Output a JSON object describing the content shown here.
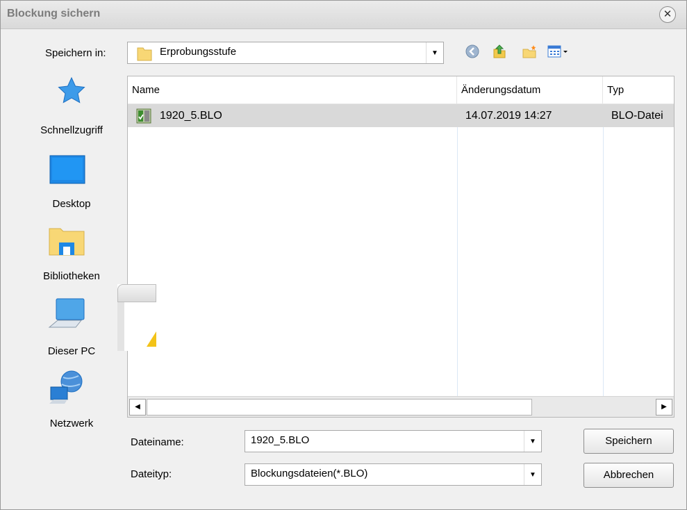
{
  "window": {
    "title": "Blockung sichern"
  },
  "save_in": {
    "label": "Speichern in:",
    "folder": "Erprobungsstufe"
  },
  "toolbar": {
    "back_icon": "back-arrow-icon",
    "up_icon": "up-folder-icon",
    "new_folder_icon": "new-folder-icon",
    "view_icon": "view-menu-icon"
  },
  "places": [
    {
      "label": "Schnellzugriff",
      "icon": "star-icon"
    },
    {
      "label": "Desktop",
      "icon": "desktop-icon"
    },
    {
      "label": "Bibliotheken",
      "icon": "libraries-icon"
    },
    {
      "label": "Dieser PC",
      "icon": "computer-icon"
    },
    {
      "label": "Netzwerk",
      "icon": "network-icon"
    }
  ],
  "filelist": {
    "columns": [
      "Name",
      "Änderungsdatum",
      "Typ"
    ],
    "rows": [
      {
        "name": "1920_5.BLO",
        "date": "14.07.2019 14:27",
        "type": "BLO-Datei",
        "icon": "blo-file-icon"
      }
    ]
  },
  "filename": {
    "label": "Dateiname:",
    "value": "1920_5.BLO"
  },
  "filetype": {
    "label": "Dateityp:",
    "value": "Blockungsdateien(*.BLO)"
  },
  "buttons": {
    "save": "Speichern",
    "cancel": "Abbrechen"
  },
  "colors": {
    "row_selected": "#d9d9d9",
    "folder_yellow": "#f8d775",
    "accent_blue": "#1e90ff"
  }
}
